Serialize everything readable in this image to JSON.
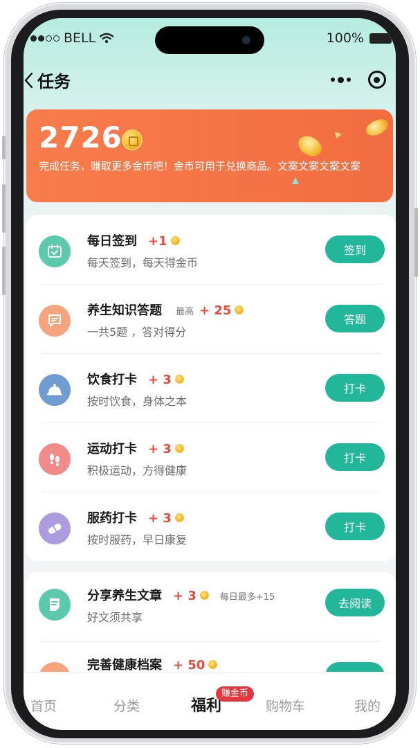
{
  "status_bar": {
    "carrier": "BELL",
    "battery": "100%"
  },
  "nav": {
    "title": "任务"
  },
  "summary": {
    "coins": "2726",
    "description": "完成任务，赚取更多金币吧！金币可用于兑换商品。文案文案文案文案"
  },
  "daily_tasks": [
    {
      "title": "每日签到",
      "reward": "+1",
      "prefix": "",
      "note": "",
      "subtitle": "每天签到，每天得金币",
      "action": "签到",
      "icon": "calendar-check-icon",
      "icon_color": "#5cc9ad"
    },
    {
      "title": "养生知识答题",
      "reward": "+ 25",
      "prefix": "最高",
      "note": "",
      "subtitle": "一共5题 ，答对得分",
      "action": "答题",
      "icon": "quiz-answer-icon",
      "icon_color": "#f5a47e"
    },
    {
      "title": "饮食打卡",
      "reward": "+ 3",
      "prefix": "",
      "note": "",
      "subtitle": "按时饮食，身体之本",
      "action": "打卡",
      "icon": "food-cloche-icon",
      "icon_color": "#6f9cd1"
    },
    {
      "title": "运动打卡",
      "reward": "+ 3",
      "prefix": "",
      "note": "",
      "subtitle": "积极运动，方得健康",
      "action": "打卡",
      "icon": "footprints-icon",
      "icon_color": "#f08b89"
    },
    {
      "title": "服药打卡",
      "reward": "+ 3",
      "prefix": "",
      "note": "",
      "subtitle": "按时服药，早日康复",
      "action": "打卡",
      "icon": "pill-icon",
      "icon_color": "#ad9be0"
    }
  ],
  "extra_tasks": [
    {
      "title": "分享养生文章",
      "reward": "+ 3",
      "prefix": "",
      "note": "每日最多+15",
      "subtitle": "好文须共享",
      "action": "去阅读",
      "icon": "article-icon",
      "icon_color": "#5cc9ad"
    },
    {
      "title": "完善健康档案",
      "reward": "+ 50",
      "prefix": "",
      "note": "",
      "subtitle": "",
      "action": "",
      "icon": "health-record-icon",
      "icon_color": "#f5a47e"
    }
  ],
  "tabbar": {
    "tabs": [
      "首页",
      "分类",
      "福利",
      "购物车",
      "我的"
    ],
    "active": "福利",
    "badge": "赚金币"
  },
  "colors": {
    "accent": "#22b69b",
    "banner": "#f26d41",
    "reward": "#e94b3c",
    "badge": "#e8343d"
  }
}
